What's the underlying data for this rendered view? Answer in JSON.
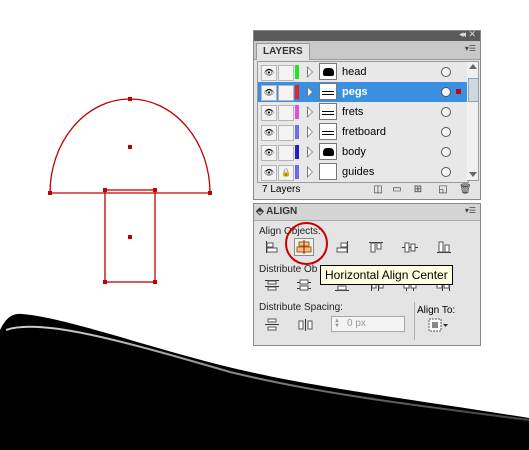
{
  "layers_panel": {
    "tab": "LAYERS",
    "count_label": "7 Layers",
    "layers": [
      {
        "name": "head",
        "color": "#25e025",
        "thumb": "filled",
        "selected": false,
        "locked": false
      },
      {
        "name": "pegs",
        "color": "#e02525",
        "thumb": "lines",
        "selected": true,
        "locked": false
      },
      {
        "name": "frets",
        "color": "#e050e0",
        "thumb": "lines",
        "selected": false,
        "locked": false
      },
      {
        "name": "fretboard",
        "color": "#7070e8",
        "thumb": "lines",
        "selected": false,
        "locked": false
      },
      {
        "name": "body",
        "color": "#2020d0",
        "thumb": "filled",
        "selected": false,
        "locked": false
      },
      {
        "name": "guides",
        "color": "#6a6af0",
        "thumb": "empty",
        "selected": false,
        "locked": true
      }
    ]
  },
  "align_panel": {
    "tab": "ALIGN",
    "align_objects_label": "Align Objects:",
    "distribute_objects_label": "Distribute Ob",
    "distribute_spacing_label": "Distribute Spacing:",
    "spacing_value": "0 px",
    "align_to_label": "Align To:"
  },
  "tooltip": "Horizontal Align Center",
  "colors": {
    "shape_stroke": "#c00000",
    "selection_blue": "#3b8fe0",
    "highlight_ring": "#cc0000"
  }
}
